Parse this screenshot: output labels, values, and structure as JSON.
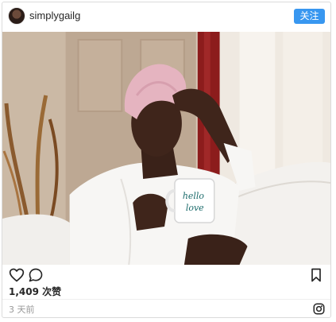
{
  "post": {
    "username": "simplygailg",
    "follow_label": "关注",
    "likes_text": "1,409 次赞",
    "time_ago": "3 天前",
    "mug_text": "hello love"
  },
  "icons": {
    "avatar": "avatar",
    "like": "heart-icon",
    "comment": "comment-icon",
    "save": "bookmark-icon",
    "brand": "instagram-icon"
  },
  "colors": {
    "follow_button": "#3897f0",
    "border": "#dbdbdb"
  }
}
